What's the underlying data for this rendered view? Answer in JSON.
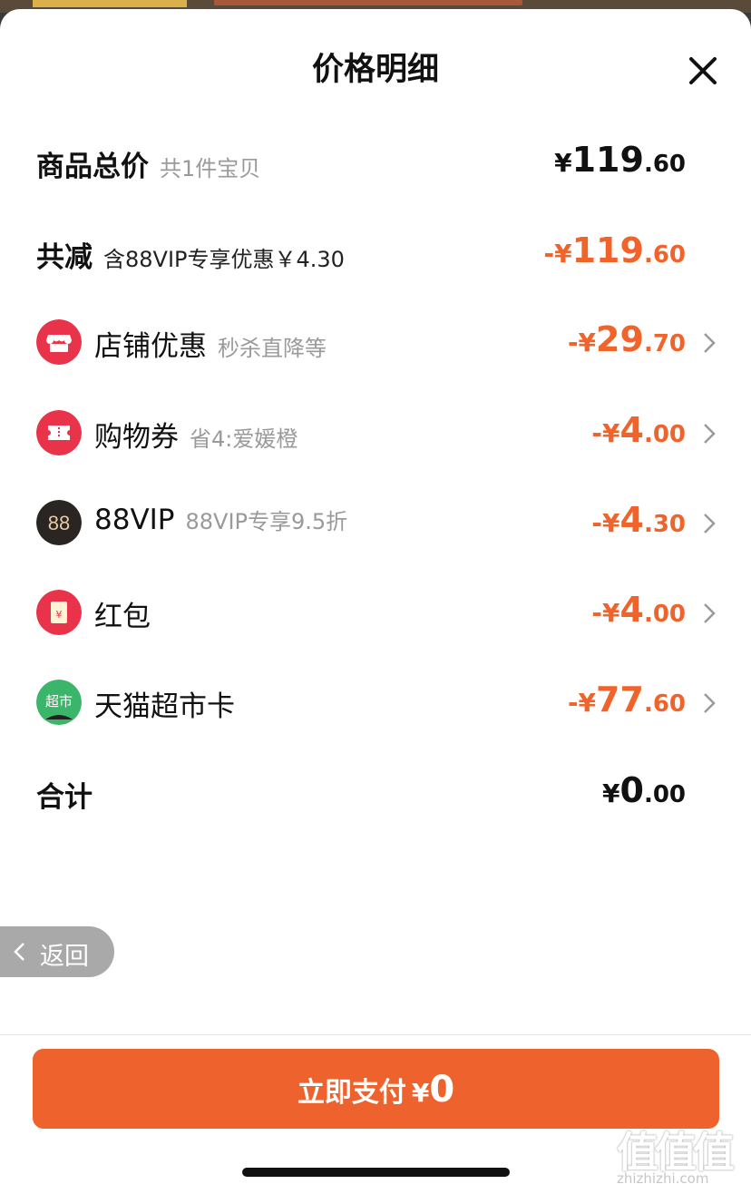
{
  "sheet": {
    "title": "价格明细"
  },
  "rows": {
    "total_price": {
      "label": "商品总价",
      "sub": "共1件宝贝",
      "cur": "¥",
      "int": "119",
      "dec": ".60"
    },
    "reduced": {
      "label": "共减",
      "sub": "含88VIP专享优惠￥4.30",
      "cur": "-¥",
      "int": "119",
      "dec": ".60"
    },
    "store_discount": {
      "label": "店铺优惠",
      "sub": "秒杀直降等",
      "cur": "-¥",
      "int": "29",
      "dec": ".70",
      "icon": "store-icon",
      "icon_color": "#e8334a"
    },
    "coupon": {
      "label": "购物券",
      "sub": "省4:爱媛橙",
      "cur": "-¥",
      "int": "4",
      "dec": ".00",
      "icon": "ticket-icon",
      "icon_color": "#e8334a"
    },
    "vip": {
      "label": "88VIP",
      "sub": "88VIP专享9.5折",
      "cur": "-¥",
      "int": "4",
      "dec": ".30",
      "icon": "88vip-icon",
      "icon_text": "88",
      "icon_color": "#2a2522"
    },
    "red_packet": {
      "label": "红包",
      "cur": "-¥",
      "int": "4",
      "dec": ".00",
      "icon": "red-packet-icon",
      "icon_text": "¥",
      "icon_color": "#e8334a"
    },
    "tmall_card": {
      "label": "天猫超市卡",
      "cur": "-¥",
      "int": "77",
      "dec": ".60",
      "icon": "tmall-supermarket-icon",
      "icon_text": "超市",
      "icon_color": "#3bb56a"
    },
    "sum": {
      "label": "合计",
      "cur": "¥",
      "int": "0",
      "dec": ".00"
    }
  },
  "back_pill": {
    "label": "返回"
  },
  "pay_button": {
    "label": "立即支付",
    "cur": "¥",
    "value": "0"
  },
  "watermark": {
    "big": "值值值",
    "small": "zhizhizhi.com"
  },
  "colors": {
    "accent": "#f0632a",
    "button": "#ee622d"
  }
}
